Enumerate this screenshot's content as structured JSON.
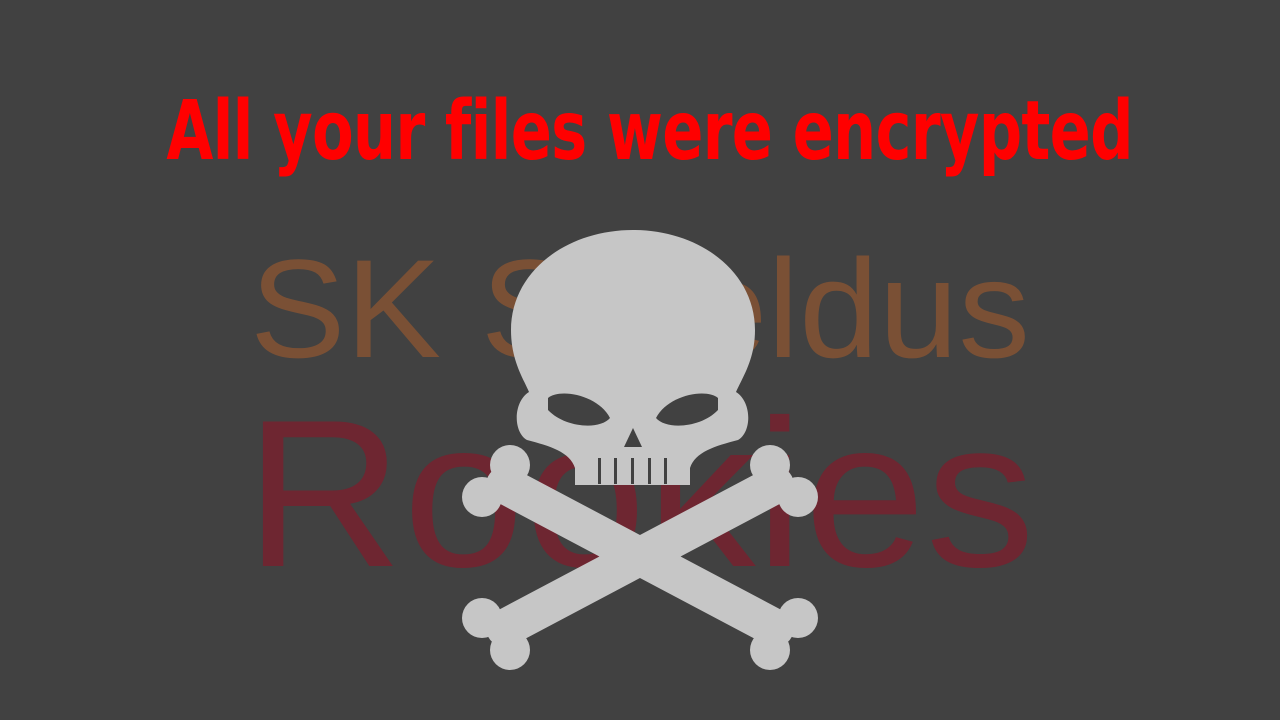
{
  "screen": {
    "headline": "All your files were encrypted",
    "headline_color": "#ff0000",
    "background_color": "#414141"
  },
  "watermark": {
    "line1": "SK Shieldus",
    "line2": "Rookies",
    "line1_color": "#7a5035",
    "line2_color": "#6e2631"
  },
  "emblem": {
    "icon": "skull-and-crossbones-icon",
    "color": "#c6c6c6"
  }
}
